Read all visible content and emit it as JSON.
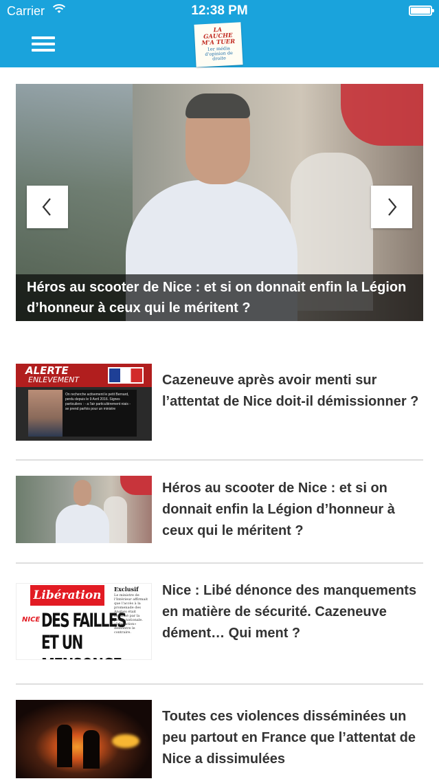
{
  "status_bar": {
    "carrier": "Carrier",
    "time": "12:38 PM"
  },
  "header": {
    "menu_icon": "hamburger-menu-icon",
    "logo": {
      "title": "LA GAUCHE M'A TUER",
      "subtitle": "1er média d'opinion de droite"
    }
  },
  "hero": {
    "caption": "Héros au scooter de Nice : et si on donnait enfin la Légion d’honneur à ceux qui le méritent ?",
    "prev_icon": "chevron-left-icon",
    "next_icon": "chevron-right-icon"
  },
  "articles": [
    {
      "title": "Cazeneuve après avoir menti sur l’attentat de Nice doit-il démissionner ?",
      "thumb": {
        "alert": "ALERTE",
        "alert_sub": "ENLEVEMENT",
        "panel_text": "On recherche activement le petit Bernard, perdu depuis le 9 Avril 2016. Signes particuliers : - a l'air particulièrement niais - se prend parfois pour un ministre"
      }
    },
    {
      "title": "Héros au scooter de Nice : et si on donnait enfin la Légion d’honneur à ceux qui le méritent ?"
    },
    {
      "title": "Nice : Libé dénonce des manquements en matière de sécurité. Cazeneuve dément… Qui ment ?",
      "thumb": {
        "masthead": "Libération",
        "tag": "NICE",
        "headline_line1": "DES FAILLES",
        "headline_line2": "ET UN MENSONGE",
        "exclusive": "Exclusif",
        "exclusive_text": "Le ministre de l'Intérieur affirmait que l'accès à la promenade des Anglais était sécurisé par la police nationale. «Libération» démontre le contraire."
      }
    },
    {
      "title": "Toutes ces violences disséminées un peu partout en France que l’attentat de Nice a dissimulées"
    }
  ],
  "colors": {
    "brand_blue": "#1aa3dc",
    "text_dark": "#333333",
    "separator": "#dedede"
  }
}
